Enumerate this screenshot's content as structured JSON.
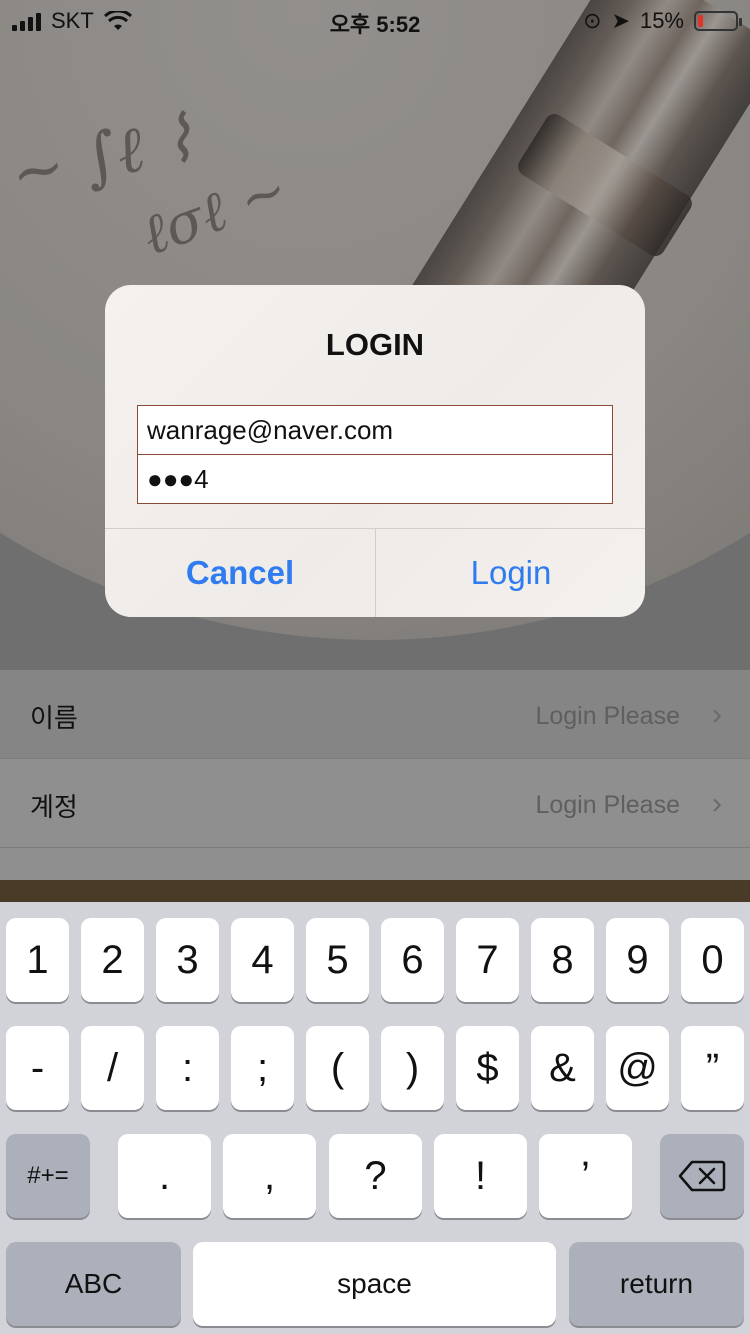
{
  "status_bar": {
    "carrier": "SKT",
    "time": "오후 5:52",
    "battery_percent": "15%",
    "battery_level": 0.15
  },
  "dialog": {
    "title": "LOGIN",
    "email_value": "wanrage@naver.com",
    "password_display": "●●●4",
    "cancel_label": "Cancel",
    "login_label": "Login"
  },
  "list": {
    "rows": [
      {
        "label": "이름",
        "value": "Login Please"
      },
      {
        "label": "계정",
        "value": "Login Please"
      }
    ]
  },
  "keyboard": {
    "row1": [
      "1",
      "2",
      "3",
      "4",
      "5",
      "6",
      "7",
      "8",
      "9",
      "0"
    ],
    "row2": [
      "-",
      "/",
      ":",
      ";",
      "(",
      ")",
      "$",
      "&",
      "@",
      "”"
    ],
    "row3": [
      ".",
      ",",
      "?",
      "!",
      "’"
    ],
    "symbols_key": "#+=",
    "abc_key": "ABC",
    "space_key": "space",
    "return_key": "return",
    "delete_icon": "backspace-icon"
  },
  "colors": {
    "accent": "#2f7cf0",
    "battery_low": "#e0332a"
  }
}
